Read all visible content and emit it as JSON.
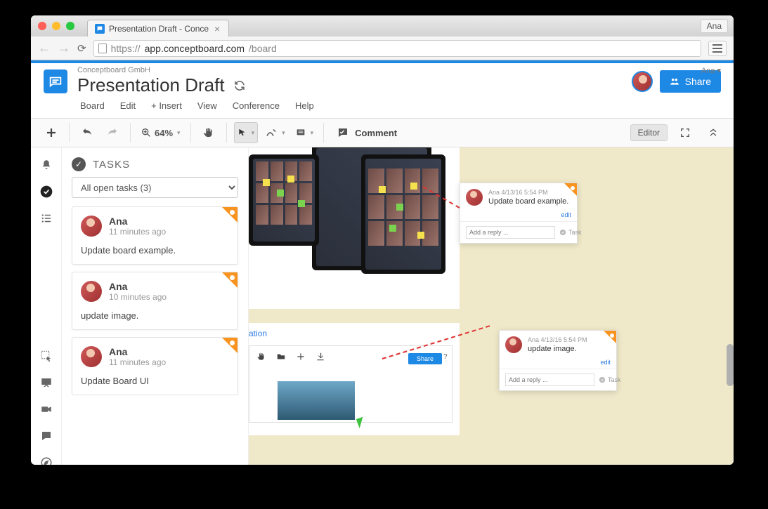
{
  "chrome": {
    "tab_title": "Presentation Draft - Conce",
    "profile": "Ana",
    "url_scheme": "https://",
    "url_domain": "app.conceptboard.com",
    "url_path": "/board"
  },
  "header": {
    "org": "Conceptboard GmbH",
    "title": "Presentation Draft",
    "user_menu": "Ana ▾",
    "share_label": "Share"
  },
  "menu": {
    "board": "Board",
    "edit": "Edit",
    "insert": "+ Insert",
    "view": "View",
    "conference": "Conference",
    "help": "Help"
  },
  "toolbar": {
    "zoom": "64%",
    "comment": "Comment",
    "editor": "Editor"
  },
  "tasks": {
    "heading": "TASKS",
    "filter_selected": "All open tasks (3)",
    "items": [
      {
        "author": "Ana",
        "time": "11 minutes ago",
        "text": "Update board example."
      },
      {
        "author": "Ana",
        "time": "10 minutes ago",
        "text": "update image."
      },
      {
        "author": "Ana",
        "time": "11 minutes ago",
        "text": "Update Board UI"
      }
    ]
  },
  "popups": [
    {
      "meta": "Ana 4/13/16 5:54 PM",
      "text": "Update board example.",
      "edit": "edit",
      "reply_ph": "Add a reply ...",
      "task": "Task"
    },
    {
      "meta": "Ana 4/13/16 5:54 PM",
      "text": "update image.",
      "edit": "edit",
      "reply_ph": "Add a reply ...",
      "task": "Task"
    }
  ],
  "canvas": {
    "label_text": "ation"
  }
}
